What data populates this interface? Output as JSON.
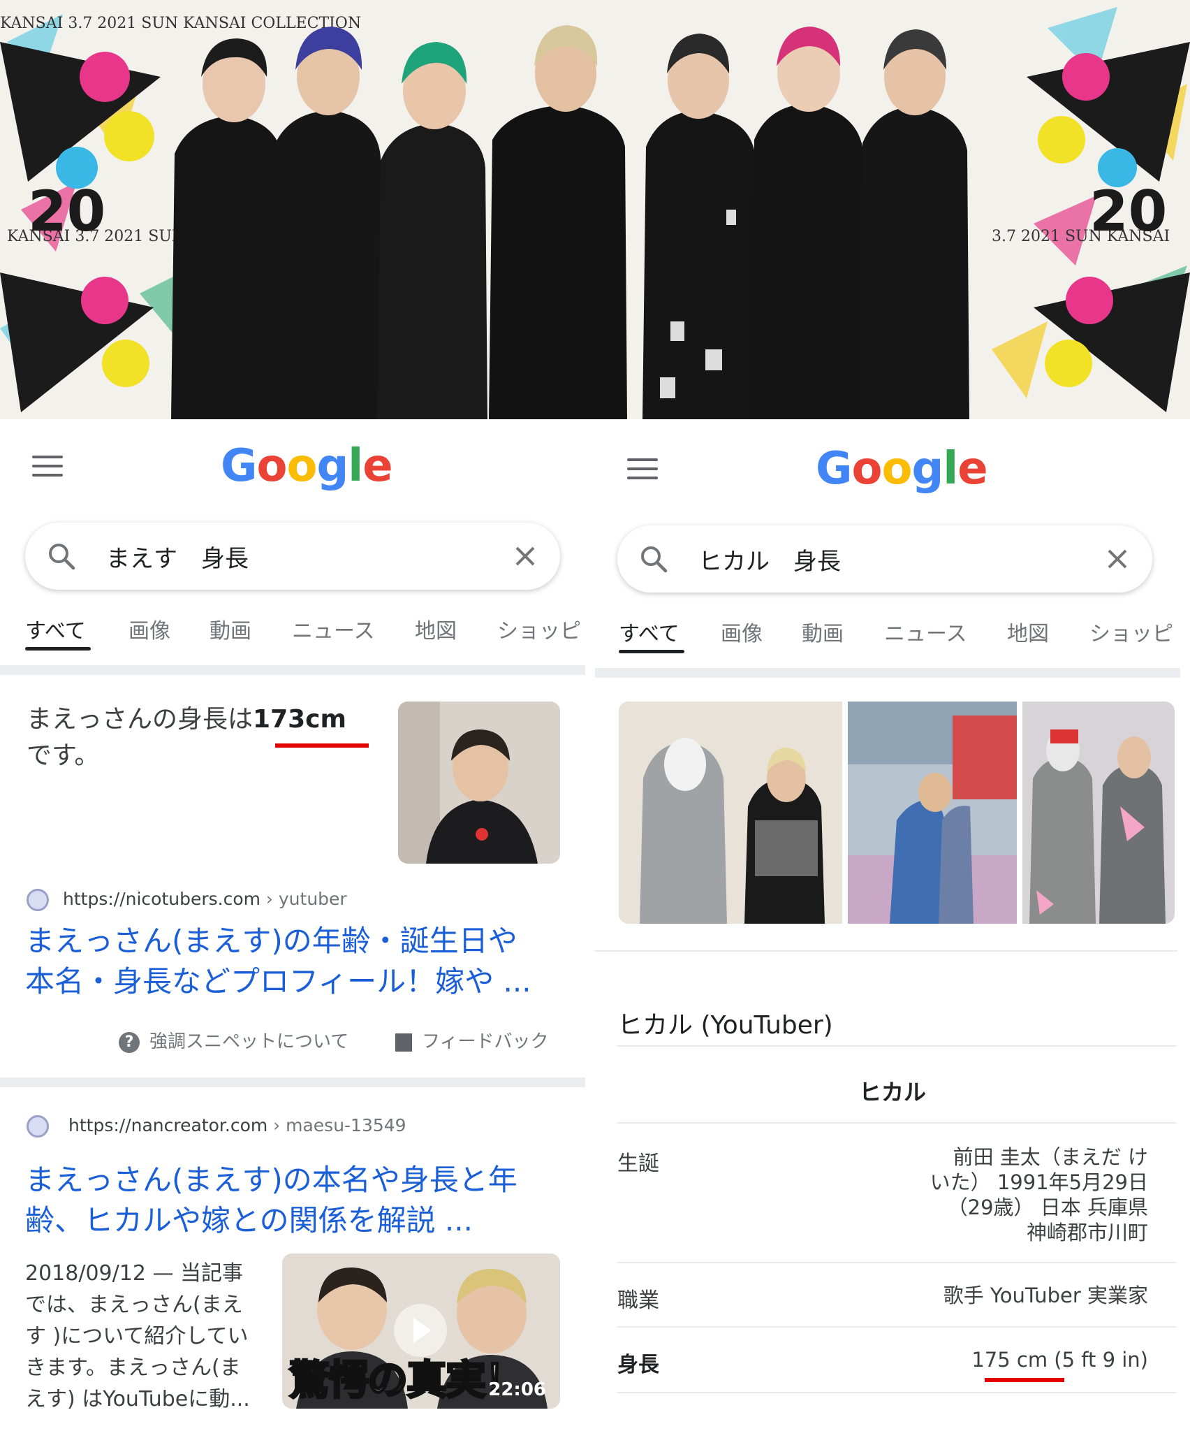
{
  "photo": {
    "backdrop_text": "KANSAI 3.7 2021 SUN KANSAI COLLECTION",
    "backdrop_numeral": "20",
    "hair_colors": [
      "#1c1c1c",
      "#3d3f9e",
      "#1fa37a",
      "#d8c79a",
      "#2a2a2a",
      "#d6327a",
      "#3a3a3a"
    ]
  },
  "left": {
    "logo": "Google",
    "search_query": "まえす　身長",
    "tabs": [
      "すべて",
      "画像",
      "動画",
      "ニュース",
      "地図",
      "ショッピ"
    ],
    "active_tab": "すべて",
    "answer_prefix": "まえっさんの身長は",
    "answer_value": "173cm",
    "answer_suffix": "です。",
    "result1": {
      "site": "https://nicotubers.com",
      "crumb": " › yutuber",
      "title_line1": "まえっさん(まえす)の年齢・誕生日や",
      "title_line2": "本名・身長などプロフィール！嫁や ..."
    },
    "about_snippet": "強調スニペットについて",
    "feedback": "フィードバック",
    "result2": {
      "site": "https://nancreator.com",
      "crumb": " › maesu-13549",
      "title_line1": "まえっさん(まえす)の本名や身長と年",
      "title_line2": "齢、ヒカルや嫁との関係を解説 ...",
      "snippet_line1": "2018/09/12 — 当記事",
      "snippet_line2": "では、まえっさん(まえ",
      "snippet_line3": "す )について紹介してい",
      "snippet_line4": "きます。まえっさん(ま",
      "snippet_line5": "えす) はYouTubeに動...",
      "video_caption": "驚愕の真実！",
      "video_duration": "22:06"
    }
  },
  "right": {
    "logo": "Google",
    "search_query": "ヒカル　身長",
    "tabs": [
      "すべて",
      "画像",
      "動画",
      "ニュース",
      "地図",
      "ショッピ"
    ],
    "active_tab": "すべて",
    "kp_title": "ヒカル (YouTuber)",
    "kp_name": "ヒカル",
    "born_label": "生誕",
    "born_line1": "前田 圭太（まえだ け",
    "born_line2": "いた） 1991年5月29日",
    "born_line3": "（29歳） 日本 兵庫県",
    "born_line4": "神崎郡市川町",
    "job_label": "職業",
    "job_value": "歌手 YouTuber 実業家",
    "height_label": "身長",
    "height_value": "175 cm",
    "height_imperial": " (5 ft 9 in)"
  },
  "colors": {
    "link": "#1a5fd8",
    "highlight_underline": "#e00000",
    "divider": "#ebedf0"
  }
}
